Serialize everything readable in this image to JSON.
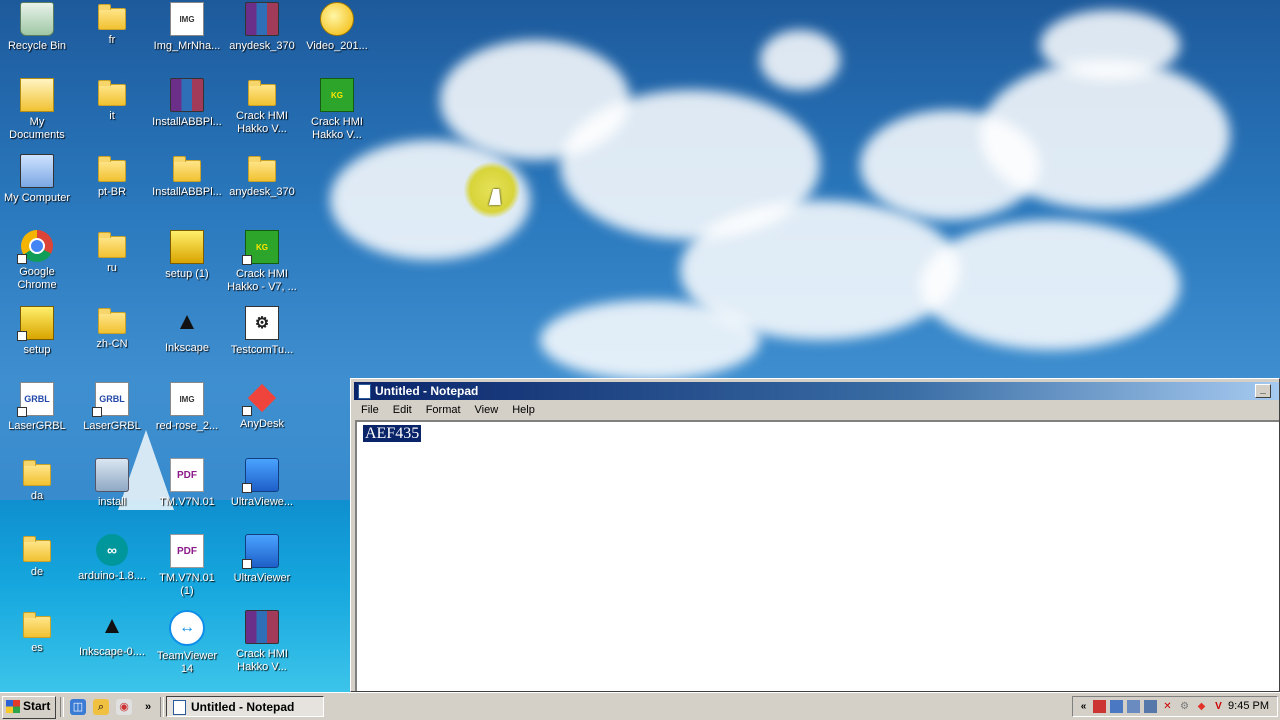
{
  "desktop": {
    "icons": [
      {
        "label": "Recycle Bin",
        "icon": "recycle-bin-icon"
      },
      {
        "label": "fr",
        "icon": "folder-icon"
      },
      {
        "label": "Img_MrNha...",
        "icon": "image-file-icon"
      },
      {
        "label": "anydesk_370",
        "icon": "winrar-archive-icon"
      },
      {
        "label": "Video_201...",
        "icon": "video-file-icon"
      },
      {
        "label": "My Documents",
        "icon": "my-documents-icon"
      },
      {
        "label": "it",
        "icon": "folder-icon"
      },
      {
        "label": "InstallABBPl...",
        "icon": "winrar-archive-icon"
      },
      {
        "label": "Crack HMI Hakko V...",
        "icon": "folder-icon"
      },
      {
        "label": "Crack HMI Hakko V...",
        "icon": "crack-keygen-icon"
      },
      {
        "label": "My Computer",
        "icon": "my-computer-icon"
      },
      {
        "label": "pt-BR",
        "icon": "folder-icon"
      },
      {
        "label": "InstallABBPl...",
        "icon": "folder-icon"
      },
      {
        "label": "anydesk_370",
        "icon": "folder-icon"
      },
      {
        "label": "Google Chrome",
        "icon": "chrome-icon"
      },
      {
        "label": "ru",
        "icon": "folder-icon"
      },
      {
        "label": "setup (1)",
        "icon": "setup-installer-icon"
      },
      {
        "label": "Crack HMI Hakko - V7, ...",
        "icon": "crack-keygen-icon"
      },
      {
        "label": "setup",
        "icon": "setup-installer-icon"
      },
      {
        "label": "zh-CN",
        "icon": "folder-icon"
      },
      {
        "label": "Inkscape",
        "icon": "inkscape-icon"
      },
      {
        "label": "TestcomTu...",
        "icon": "application-icon"
      },
      {
        "label": "LaserGRBL",
        "icon": "lasergrbl-icon"
      },
      {
        "label": "LaserGRBL",
        "icon": "lasergrbl-icon"
      },
      {
        "label": "red-rose_2...",
        "icon": "image-file-icon"
      },
      {
        "label": "AnyDesk",
        "icon": "anydesk-icon"
      },
      {
        "label": "da",
        "icon": "folder-icon"
      },
      {
        "label": "install",
        "icon": "installer-icon"
      },
      {
        "label": "TM.V7N.01",
        "icon": "pdf-file-icon"
      },
      {
        "label": "UltraViewe...",
        "icon": "ultraviewer-icon"
      },
      {
        "label": "de",
        "icon": "folder-icon"
      },
      {
        "label": "arduino-1.8....",
        "icon": "arduino-icon"
      },
      {
        "label": "TM.V7N.01 (1)",
        "icon": "pdf-file-icon"
      },
      {
        "label": "UltraViewer",
        "icon": "ultraviewer-icon"
      },
      {
        "label": "es",
        "icon": "folder-icon"
      },
      {
        "label": "Inkscape-0....",
        "icon": "inkscape-icon"
      },
      {
        "label": "TeamViewer 14",
        "icon": "teamviewer-icon"
      },
      {
        "label": "Crack HMI Hakko V...",
        "icon": "winrar-archive-icon"
      }
    ]
  },
  "notepad": {
    "title": "Untitled - Notepad",
    "menu": [
      "File",
      "Edit",
      "Format",
      "View",
      "Help"
    ],
    "selected_text": "AEF435"
  },
  "taskbar": {
    "start_label": "Start",
    "task_button_label": "Untitled - Notepad",
    "clock": "9:45 PM",
    "tray_expand": "«"
  }
}
